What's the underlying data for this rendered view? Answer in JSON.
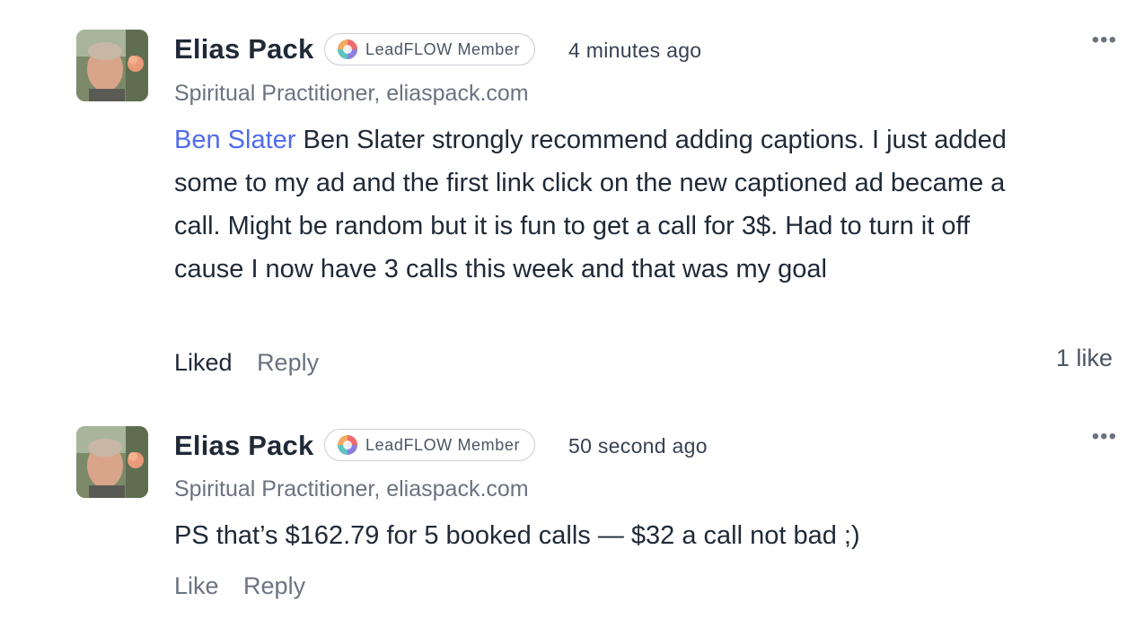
{
  "comments": [
    {
      "author": "Elias Pack",
      "badge": "LeadFLOW Member",
      "time": "4 minutes ago",
      "subtitle": "Spiritual Practitioner, eliaspack.com",
      "mention": "Ben Slater",
      "text": " Ben Slater strongly recommend adding captions. I just added some to my ad and the first link click on the new captioned ad became a call. Might be random but it is fun to get a call for 3$. Had to turn it off cause I now have 3 calls this week and that was my goal",
      "like_action": "Liked",
      "reply_action": "Reply",
      "like_count": "1 like",
      "more_icon": "more-horizontal-icon"
    },
    {
      "author": "Elias Pack",
      "badge": "LeadFLOW Member",
      "time": "50 second ago",
      "subtitle": "Spiritual Practitioner, eliaspack.com",
      "text": "PS that’s $162.79 for 5 booked calls — $32 a call not bad ;)",
      "like_action": "Like",
      "reply_action": "Reply",
      "more_icon": "more-horizontal-icon"
    }
  ],
  "colors": {
    "mention": "#4f6bed",
    "text": "#1f2937",
    "muted": "#6b7280",
    "badge_border": "#c9ccd2"
  }
}
